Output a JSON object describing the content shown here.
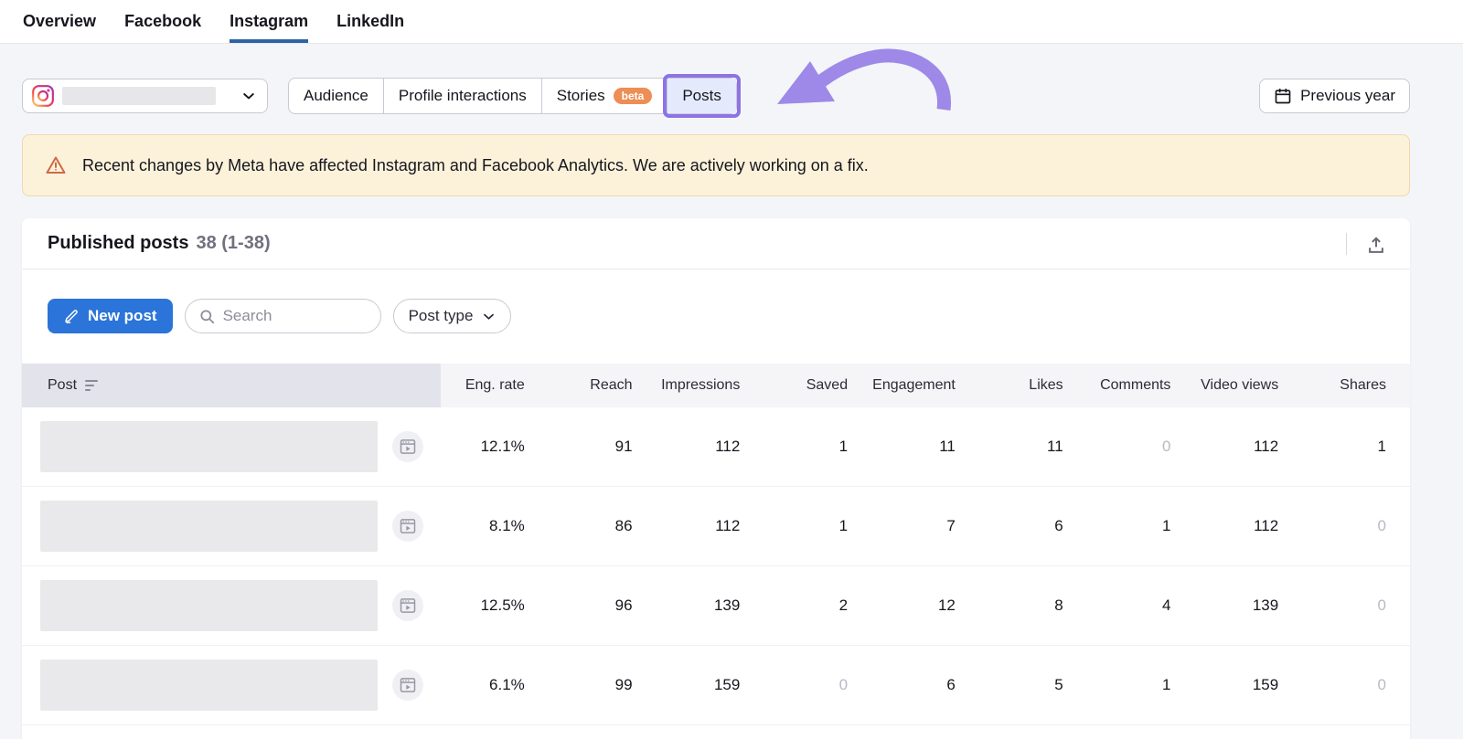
{
  "nav": {
    "tabs": [
      {
        "label": "Overview",
        "active": false
      },
      {
        "label": "Facebook",
        "active": false
      },
      {
        "label": "Instagram",
        "active": true
      },
      {
        "label": "LinkedIn",
        "active": false
      }
    ]
  },
  "account_selector": {
    "platform_icon": "instagram-icon",
    "name_hidden": true
  },
  "subtabs": {
    "items": [
      {
        "label": "Audience"
      },
      {
        "label": "Profile interactions"
      },
      {
        "label": "Stories",
        "badge": "beta"
      },
      {
        "label": "Posts",
        "highlighted": true
      }
    ]
  },
  "date_button": {
    "label": "Previous year",
    "icon": "calendar-icon"
  },
  "banner": {
    "icon": "warning-icon",
    "text": "Recent changes by Meta have affected Instagram and Facebook Analytics. We are actively working on a fix."
  },
  "panel": {
    "title": "Published posts",
    "count": "38 (1-38)"
  },
  "toolbar": {
    "new_post": "New post",
    "search_placeholder": "Search",
    "post_type": "Post type"
  },
  "table": {
    "columns": [
      "Post",
      "Eng. rate",
      "Reach",
      "Impressions",
      "Saved",
      "Engagement",
      "Likes",
      "Comments",
      "Video views",
      "Shares"
    ],
    "rows": [
      {
        "media": "video",
        "values": [
          "12.1%",
          "91",
          "112",
          "1",
          "11",
          "11",
          "0",
          "112",
          "1"
        ]
      },
      {
        "media": "video",
        "values": [
          "8.1%",
          "86",
          "112",
          "1",
          "7",
          "6",
          "1",
          "112",
          "0"
        ]
      },
      {
        "media": "video",
        "values": [
          "12.5%",
          "96",
          "139",
          "2",
          "12",
          "8",
          "4",
          "139",
          "0"
        ]
      },
      {
        "media": "video",
        "values": [
          "6.1%",
          "99",
          "159",
          "0",
          "6",
          "5",
          "1",
          "159",
          "0"
        ]
      }
    ]
  },
  "colors": {
    "nav_active_underline": "#2d64a3",
    "accent_blue": "#2b74d9",
    "annotation_purple": "#8d74e4",
    "arrow_purple": "#9e88e8",
    "selected_tab_bg": "#e4eafb",
    "beta_badge_orange": "#ec8e55",
    "banner_bg": "#fcf2da",
    "banner_border": "#ecd9ae",
    "warning_orange": "#cd6a47",
    "zero_value_gray": "#b9b9c3"
  }
}
